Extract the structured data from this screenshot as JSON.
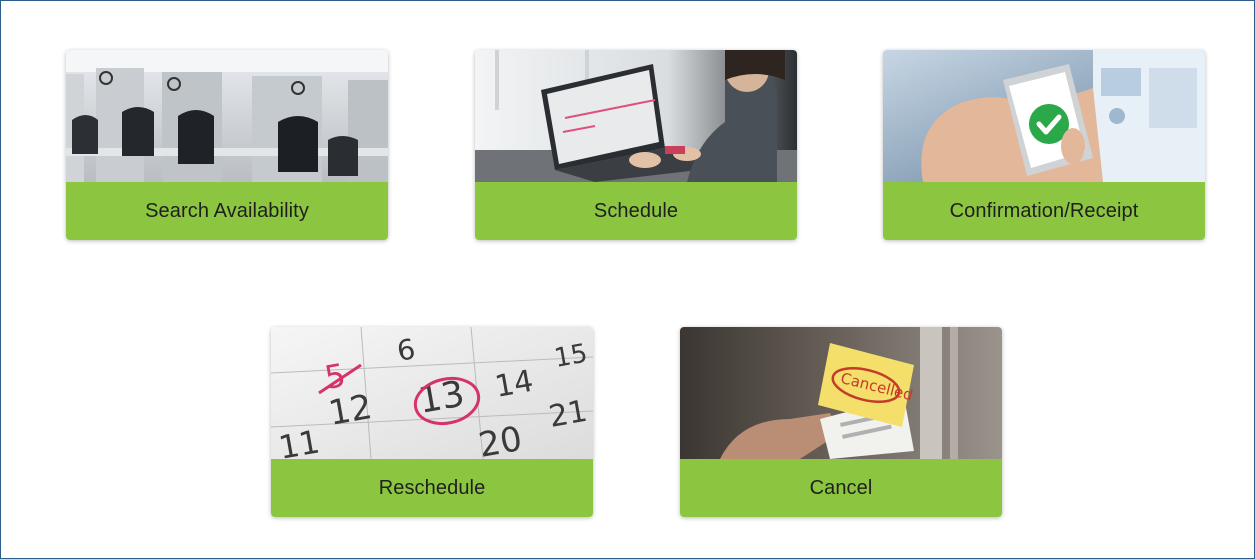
{
  "cards": [
    {
      "label": "Search Availability",
      "image": "call-center-cubicles-photo"
    },
    {
      "label": "Schedule",
      "image": "person-using-laptop-calendar-photo"
    },
    {
      "label": "Confirmation/Receipt",
      "image": "phone-checkmark-photo"
    },
    {
      "label": "Reschedule",
      "image": "calendar-circled-date-photo"
    },
    {
      "label": "Cancel",
      "image": "cancelled-note-photo",
      "stamp_text": "Cancelled"
    }
  ],
  "colors": {
    "card_bar": "#8cc641",
    "label_text": "#1f1f1f",
    "frame_border": "#2e5c8a",
    "checkmark": "#2aa84a",
    "circle_ink": "#d6336c"
  }
}
